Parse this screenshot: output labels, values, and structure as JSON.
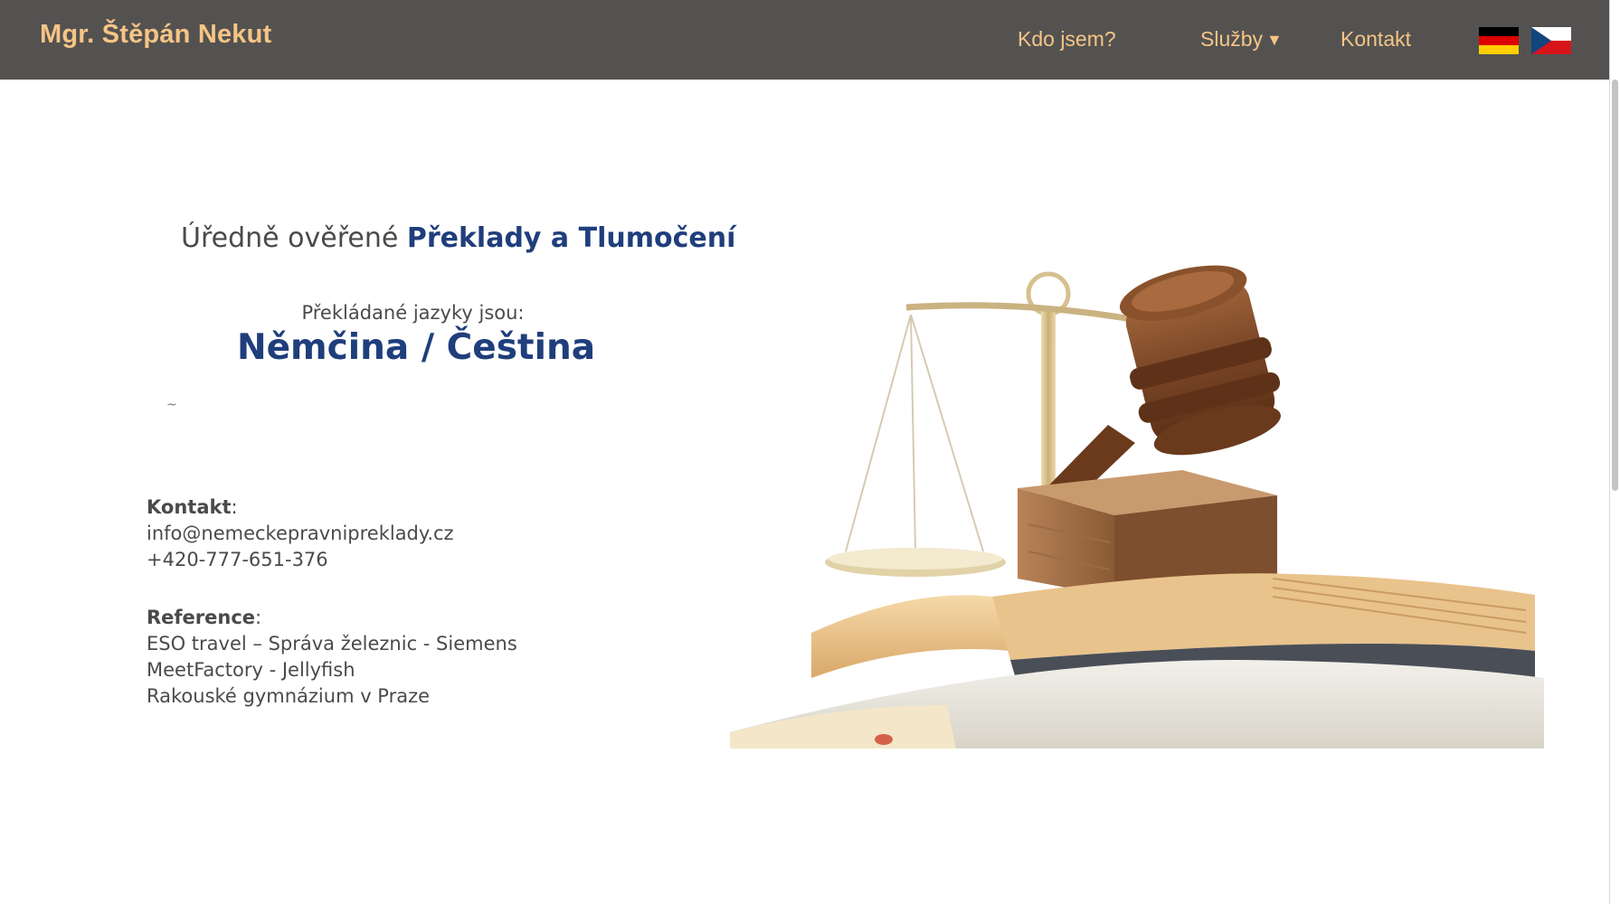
{
  "header": {
    "brand": "Mgr. Štěpán Nekut",
    "nav": [
      {
        "label": "Kdo jsem?"
      },
      {
        "label": "Služby",
        "caret": "▼"
      },
      {
        "label": "Kontakt"
      }
    ],
    "flags": [
      {
        "name": "german-flag-icon",
        "colors": [
          "#000000",
          "#dd0000",
          "#ffce00"
        ]
      },
      {
        "name": "czech-flag-icon",
        "colors": [
          "#ffffff",
          "#d7141a",
          "#11457e"
        ]
      }
    ],
    "bg_color": "#545251",
    "text_color": "#f6c585"
  },
  "main": {
    "headline_prefix": "Úředně ověřené ",
    "headline_accent": "Překlady a Tlumočení",
    "languages_label": "Překládané jazyky jsou:",
    "languages_value": "Němčina / Čeština",
    "tilde": "~",
    "contact": {
      "heading": "Kontakt",
      "email": "info@nemeckepravnipreklady.cz",
      "phone": "+420-777-651-376"
    },
    "references": {
      "heading": "Reference",
      "items": [
        "ESO travel – Správa železnic - Siemens",
        "MeetFactory - Jellyfish",
        "Rakouské gymnázium v Praze"
      ]
    },
    "accent_color": "#1f3e7c",
    "hero_image": "gavel-scales-books-illustration"
  }
}
